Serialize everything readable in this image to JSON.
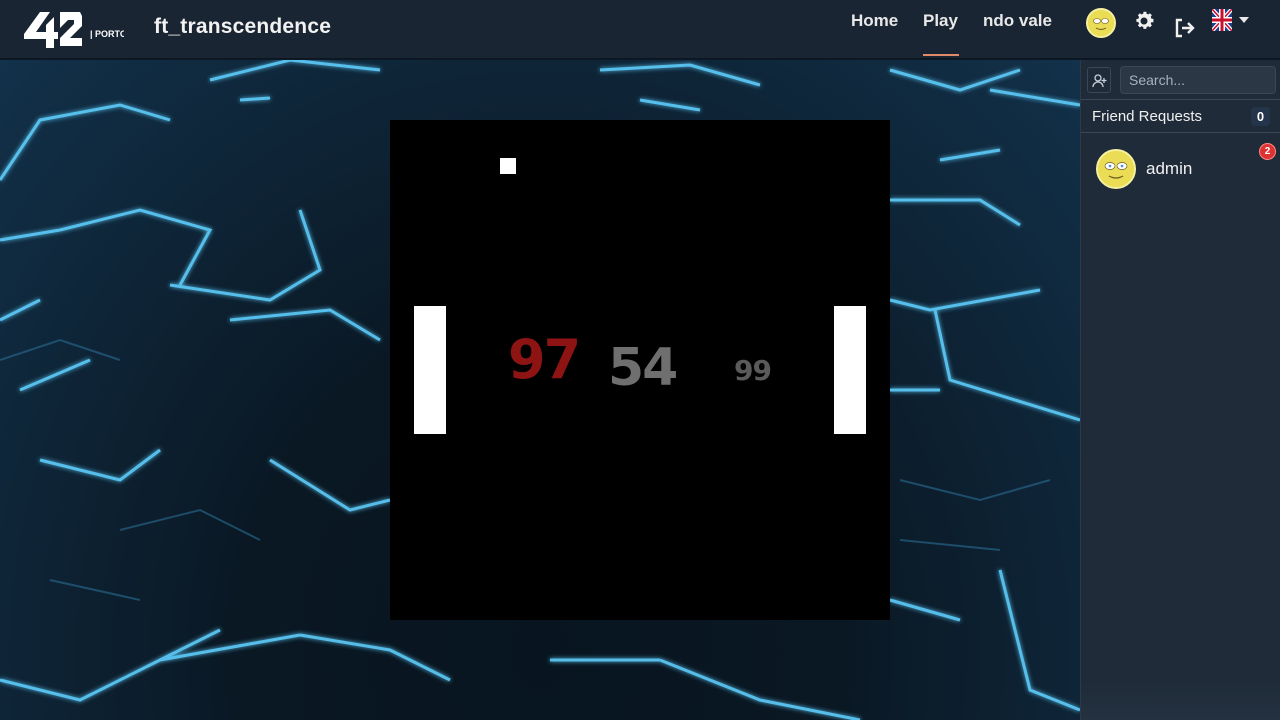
{
  "navbar": {
    "logo_main": "42",
    "logo_sub": "| PORTO",
    "brand": "ft_transcendence",
    "links": {
      "home": "Home",
      "play": "Play",
      "user": "ndo vale"
    },
    "active_link": "Play",
    "accent_color": "#e08a6a",
    "icons": [
      "avatar",
      "gear-icon",
      "logout-icon",
      "uk-flag-icon",
      "caret-down-icon"
    ]
  },
  "game": {
    "score_left": "97",
    "score_center": "54",
    "score_right": "99",
    "score_left_color": "#8e1414",
    "background": "#000000"
  },
  "sidebar": {
    "search_placeholder": "Search...",
    "friend_requests_label": "Friend Requests",
    "friend_requests_count": "0",
    "friends": [
      {
        "name": "admin",
        "notifications": "2"
      }
    ]
  }
}
